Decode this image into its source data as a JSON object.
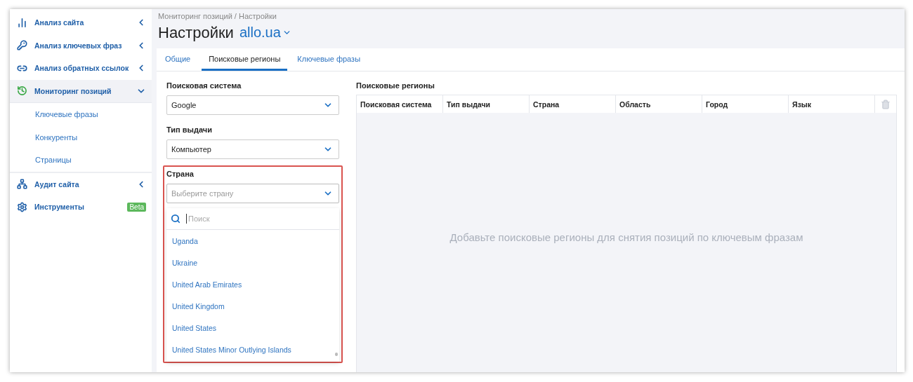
{
  "sidebar": {
    "items": [
      {
        "label": "Анализ сайта",
        "expanded": false,
        "selected": false
      },
      {
        "label": "Анализ ключевых фраз",
        "expanded": false,
        "selected": false
      },
      {
        "label": "Анализ обратных ссылок",
        "expanded": false,
        "selected": false
      },
      {
        "label": "Мониторинг позиций",
        "expanded": true,
        "selected": true,
        "children": [
          {
            "label": "Ключевые фразы"
          },
          {
            "label": "Конкуренты"
          },
          {
            "label": "Страницы"
          }
        ]
      },
      {
        "label": "Аудит сайта",
        "expanded": false,
        "selected": false
      },
      {
        "label": "Инструменты",
        "badge": "Beta",
        "selected": false
      }
    ]
  },
  "breadcrumb": "Мониторинг позиций / Настройки",
  "title": "Настройки",
  "project": "allo.ua",
  "tabs": [
    {
      "label": "Общие",
      "selected": false
    },
    {
      "label": "Поисковые регионы",
      "selected": true
    },
    {
      "label": "Ключевые фразы",
      "selected": false
    }
  ],
  "form": {
    "fields": [
      {
        "label": "Поисковая система",
        "value": "Google"
      },
      {
        "label": "Тип выдачи",
        "value": "Компьютер"
      },
      {
        "label": "Страна",
        "placeholder": "Выберите страну",
        "open": true,
        "search_placeholder": "Поиск",
        "options": [
          "Uganda",
          "Ukraine",
          "United Arab Emirates",
          "United Kingdom",
          "United States",
          "United States Minor Outlying Islands"
        ]
      }
    ]
  },
  "regions": {
    "title": "Поисковые регионы",
    "columns": [
      "Поисковая система",
      "Тип выдачи",
      "Страна",
      "Область",
      "Город",
      "Язык"
    ],
    "empty_message": "Добавьте поисковые регионы для снятия позиций по ключевым фразам"
  }
}
